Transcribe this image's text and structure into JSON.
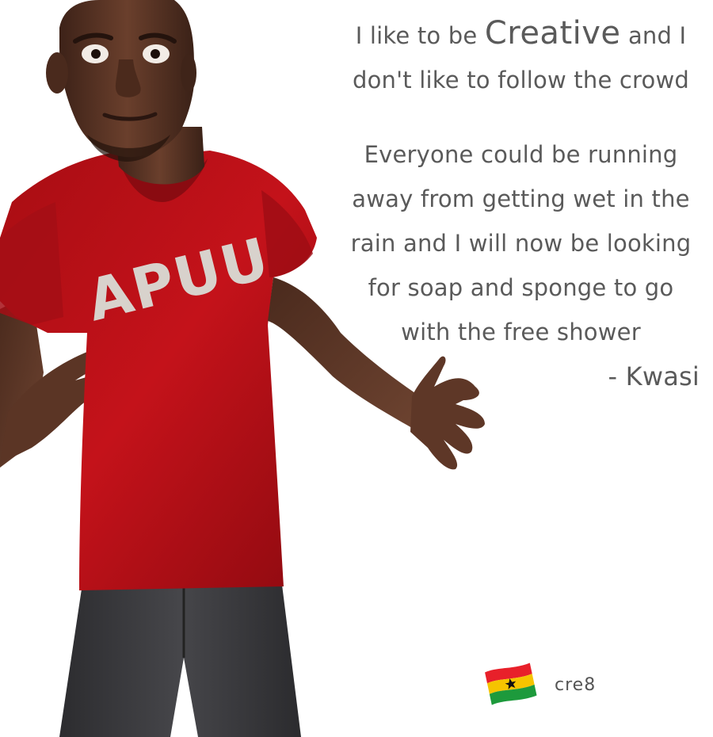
{
  "quote": {
    "line1_pre": "I like to be ",
    "line1_emph": "Creative",
    "line1_post": " and I",
    "line2": "don't like to follow the crowd",
    "line3": "Everyone could be running",
    "line4": "away from getting wet in the",
    "line5": "rain and I will now be looking",
    "line6": "for soap and sponge to go",
    "line7": "with the free shower",
    "author": "- Kwasi"
  },
  "character": {
    "shirt_text": "APUU",
    "shirt_color": "#c4121a",
    "skin_color": "#5a3526",
    "pants_color": "#3b3b3e"
  },
  "brand": {
    "label": "cre8",
    "flag_colors": [
      "#e8202a",
      "#f5c400",
      "#1d9a3c",
      "#111111"
    ]
  }
}
